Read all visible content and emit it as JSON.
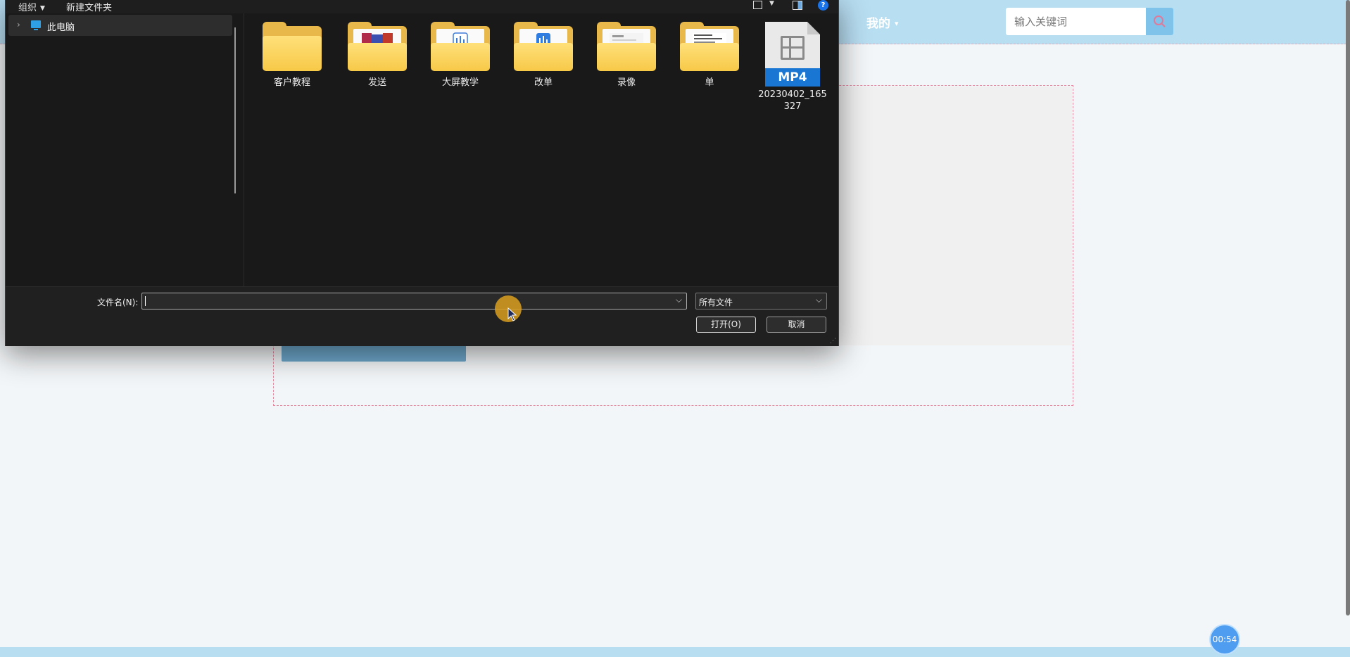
{
  "web": {
    "nav_mine": "我的",
    "search_placeholder": "输入关键词",
    "timer": "00:54"
  },
  "dialog": {
    "toolbar": {
      "organize": "组织",
      "new_folder": "新建文件夹"
    },
    "nav_items": [
      {
        "label": "此电脑",
        "icon": "computer-icon"
      }
    ],
    "files": [
      {
        "name": "客户教程",
        "type": "folder"
      },
      {
        "name": "发送",
        "type": "folder"
      },
      {
        "name": "大屏教学",
        "type": "folder"
      },
      {
        "name": "改单",
        "type": "folder"
      },
      {
        "name": "录像",
        "type": "folder"
      },
      {
        "name": "单",
        "type": "folder"
      },
      {
        "name": "20230402_165327",
        "type": "mp4",
        "badge": "MP4"
      }
    ],
    "filename_label": "文件名(N):",
    "filename_value": "",
    "filetype_value": "所有文件",
    "open_button": "打开(O)",
    "cancel_button": "取消"
  },
  "colors": {
    "header_bg": "#b8def2",
    "dialog_bg": "#191919",
    "folder_yellow": "#f7c948",
    "accent_blue": "#1976d2"
  }
}
